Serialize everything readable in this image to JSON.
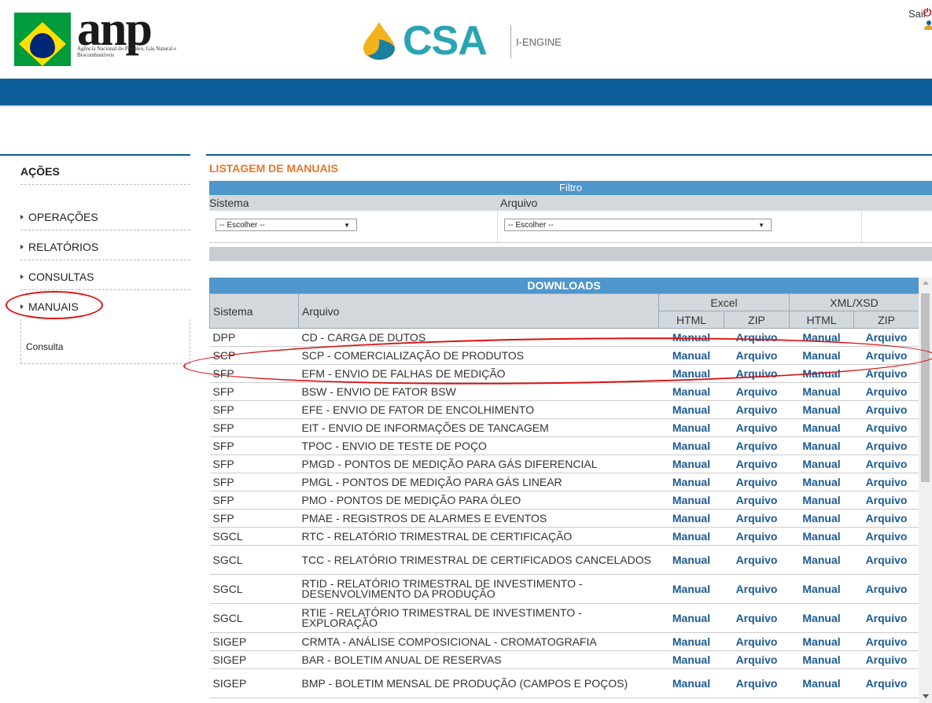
{
  "header": {
    "anp_word": "anp",
    "anp_sub": "Agência Nacional do Petróleo, Gás Natural e Biocombustíveis",
    "csa_word": "CSA",
    "csa_engine": "I-ENGINE",
    "sair": "Sair"
  },
  "sidebar": {
    "title": "AÇÕES",
    "items": [
      {
        "label": "OPERAÇÕES"
      },
      {
        "label": "RELATÓRIOS"
      },
      {
        "label": "CONSULTAS"
      },
      {
        "label": "MANUAIS"
      }
    ],
    "submenu": "Consulta"
  },
  "main": {
    "title": "LISTAGEM DE MANUAIS",
    "filter": {
      "header": "Filtro",
      "sistema_label": "Sistema",
      "arquivo_label": "Arquivo",
      "sistema_value": "-- Escolher --",
      "arquivo_value": "-- Escolher --"
    },
    "downloads": {
      "header": "DOWNLOADS",
      "col_sistema": "Sistema",
      "col_arquivo": "Arquivo",
      "grp_excel": "Excel",
      "grp_xml": "XML/XSD",
      "sub_html": "HTML",
      "sub_zip": "ZIP",
      "manual_label": "Manual",
      "arquivo_label": "Arquivo",
      "rows": [
        {
          "sistema": "DPP",
          "arquivo": "CD - CARGA DE DUTOS"
        },
        {
          "sistema": "SCP",
          "arquivo": "SCP - COMERCIALIZAÇÃO DE PRODUTOS"
        },
        {
          "sistema": "SFP",
          "arquivo": "EFM - ENVIO DE FALHAS DE MEDIÇÃO"
        },
        {
          "sistema": "SFP",
          "arquivo": "BSW - ENVIO DE FATOR BSW"
        },
        {
          "sistema": "SFP",
          "arquivo": "EFE - ENVIO DE FATOR DE ENCOLHIMENTO"
        },
        {
          "sistema": "SFP",
          "arquivo": "EIT - ENVIO DE INFORMAÇÕES DE TANCAGEM"
        },
        {
          "sistema": "SFP",
          "arquivo": "TPOC - ENVIO DE TESTE DE POÇO"
        },
        {
          "sistema": "SFP",
          "arquivo": "PMGD - PONTOS DE MEDIÇÃO PARA GÁS DIFERENCIAL"
        },
        {
          "sistema": "SFP",
          "arquivo": "PMGL - PONTOS DE MEDIÇÃO PARA GÁS LINEAR"
        },
        {
          "sistema": "SFP",
          "arquivo": "PMO - PONTOS DE MEDIÇÃO PARA ÓLEO"
        },
        {
          "sistema": "SFP",
          "arquivo": "PMAE - REGISTROS DE ALARMES E EVENTOS"
        },
        {
          "sistema": "SGCL",
          "arquivo": "RTC - RELATÓRIO TRIMESTRAL DE CERTIFICAÇÃO"
        },
        {
          "sistema": "SGCL",
          "arquivo": "TCC - RELATÓRIO TRIMESTRAL DE CERTIFICADOS CANCELADOS"
        },
        {
          "sistema": "SGCL",
          "arquivo": "RTID - RELATÓRIO TRIMESTRAL DE INVESTIMENTO - DESENVOLVIMENTO DA PRODUÇÃO"
        },
        {
          "sistema": "SGCL",
          "arquivo": "RTIE - RELATÓRIO TRIMESTRAL DE INVESTIMENTO - EXPLORAÇÃO"
        },
        {
          "sistema": "SIGEP",
          "arquivo": "CRMTA - ANÁLISE COMPOSICIONAL - CROMATOGRAFIA"
        },
        {
          "sistema": "SIGEP",
          "arquivo": "BAR - BOLETIM ANUAL DE RESERVAS"
        },
        {
          "sistema": "SIGEP",
          "arquivo": "BMP - BOLETIM MENSAL DE PRODUÇÃO (CAMPOS E POÇOS)"
        }
      ]
    }
  },
  "colors": {
    "accent_blue": "#0b5e9a",
    "title_orange": "#e8762d",
    "link_blue": "#1c5a94",
    "highlight_red": "#d11"
  }
}
